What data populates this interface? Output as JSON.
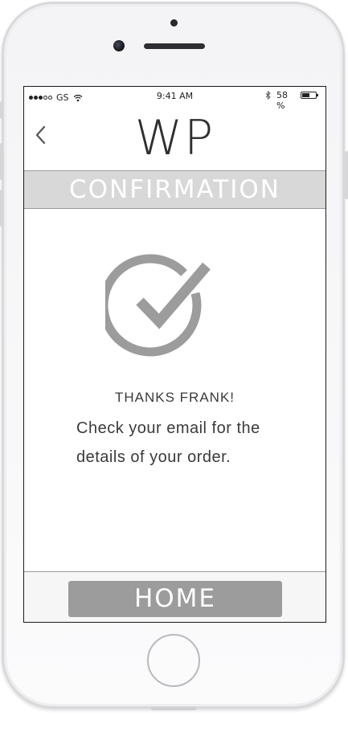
{
  "status_bar": {
    "carrier": "GS",
    "time": "9:41 AM",
    "battery_percent": "58 %",
    "battery_level": 0.58,
    "signal_bars_filled": 3,
    "signal_bars_total": 5,
    "icons": [
      "wifi-icon",
      "bluetooth-icon",
      "battery-icon"
    ]
  },
  "header": {
    "back_icon": "chevron-left-icon",
    "logo": "WP"
  },
  "page": {
    "title": "CONFIRMATION",
    "icon": "check-circle-icon",
    "thanks": "THANKS FRANK!",
    "message": "Check your email for the details of your order."
  },
  "footer": {
    "home_label": "HOME"
  },
  "colors": {
    "title_band": "#d8d8d8",
    "icon_gray": "#9c9c9c",
    "button_gray": "#9c9c9c",
    "text_dark": "#3a3a3a"
  }
}
